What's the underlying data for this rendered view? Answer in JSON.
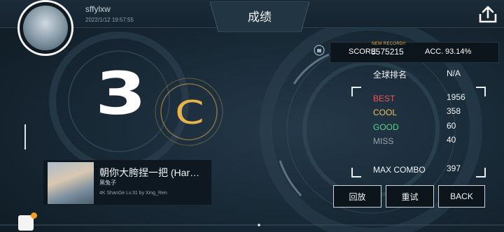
{
  "header": {
    "title": "成绩",
    "username": "sffylxw",
    "datetime": "2022/1/12 19:57:55",
    "share_icon": "share-icon"
  },
  "grade": {
    "level_number": "3",
    "rank": "C"
  },
  "song": {
    "title": "朝你大胯捏一把 (Har…",
    "artist": "黑兔子",
    "meta": "4K ShanGe Lv.31 by Xing_Ren"
  },
  "score": {
    "new_record": "NEW RECORD!!",
    "score_label": "SCORE",
    "score_value": "3575215",
    "acc_label": "ACC.",
    "acc_value": "93.14%"
  },
  "stats": {
    "global_rank_label": "全球排名",
    "global_rank_value": "N/A",
    "best_label": "BEST",
    "best_value": "1956",
    "cool_label": "COOL",
    "cool_value": "358",
    "good_label": "GOOD",
    "good_value": "60",
    "miss_label": "MISS",
    "miss_value": "40",
    "max_combo_label": "MAX COMBO",
    "max_combo_value": "397"
  },
  "colors": {
    "best": "#e0595c",
    "cool": "#e8c45a",
    "good": "#5fd08a",
    "miss": "#9aa3aa",
    "accent": "#e8b44a"
  },
  "buttons": {
    "replay": "回放",
    "retry": "重试",
    "back": "BACK"
  }
}
